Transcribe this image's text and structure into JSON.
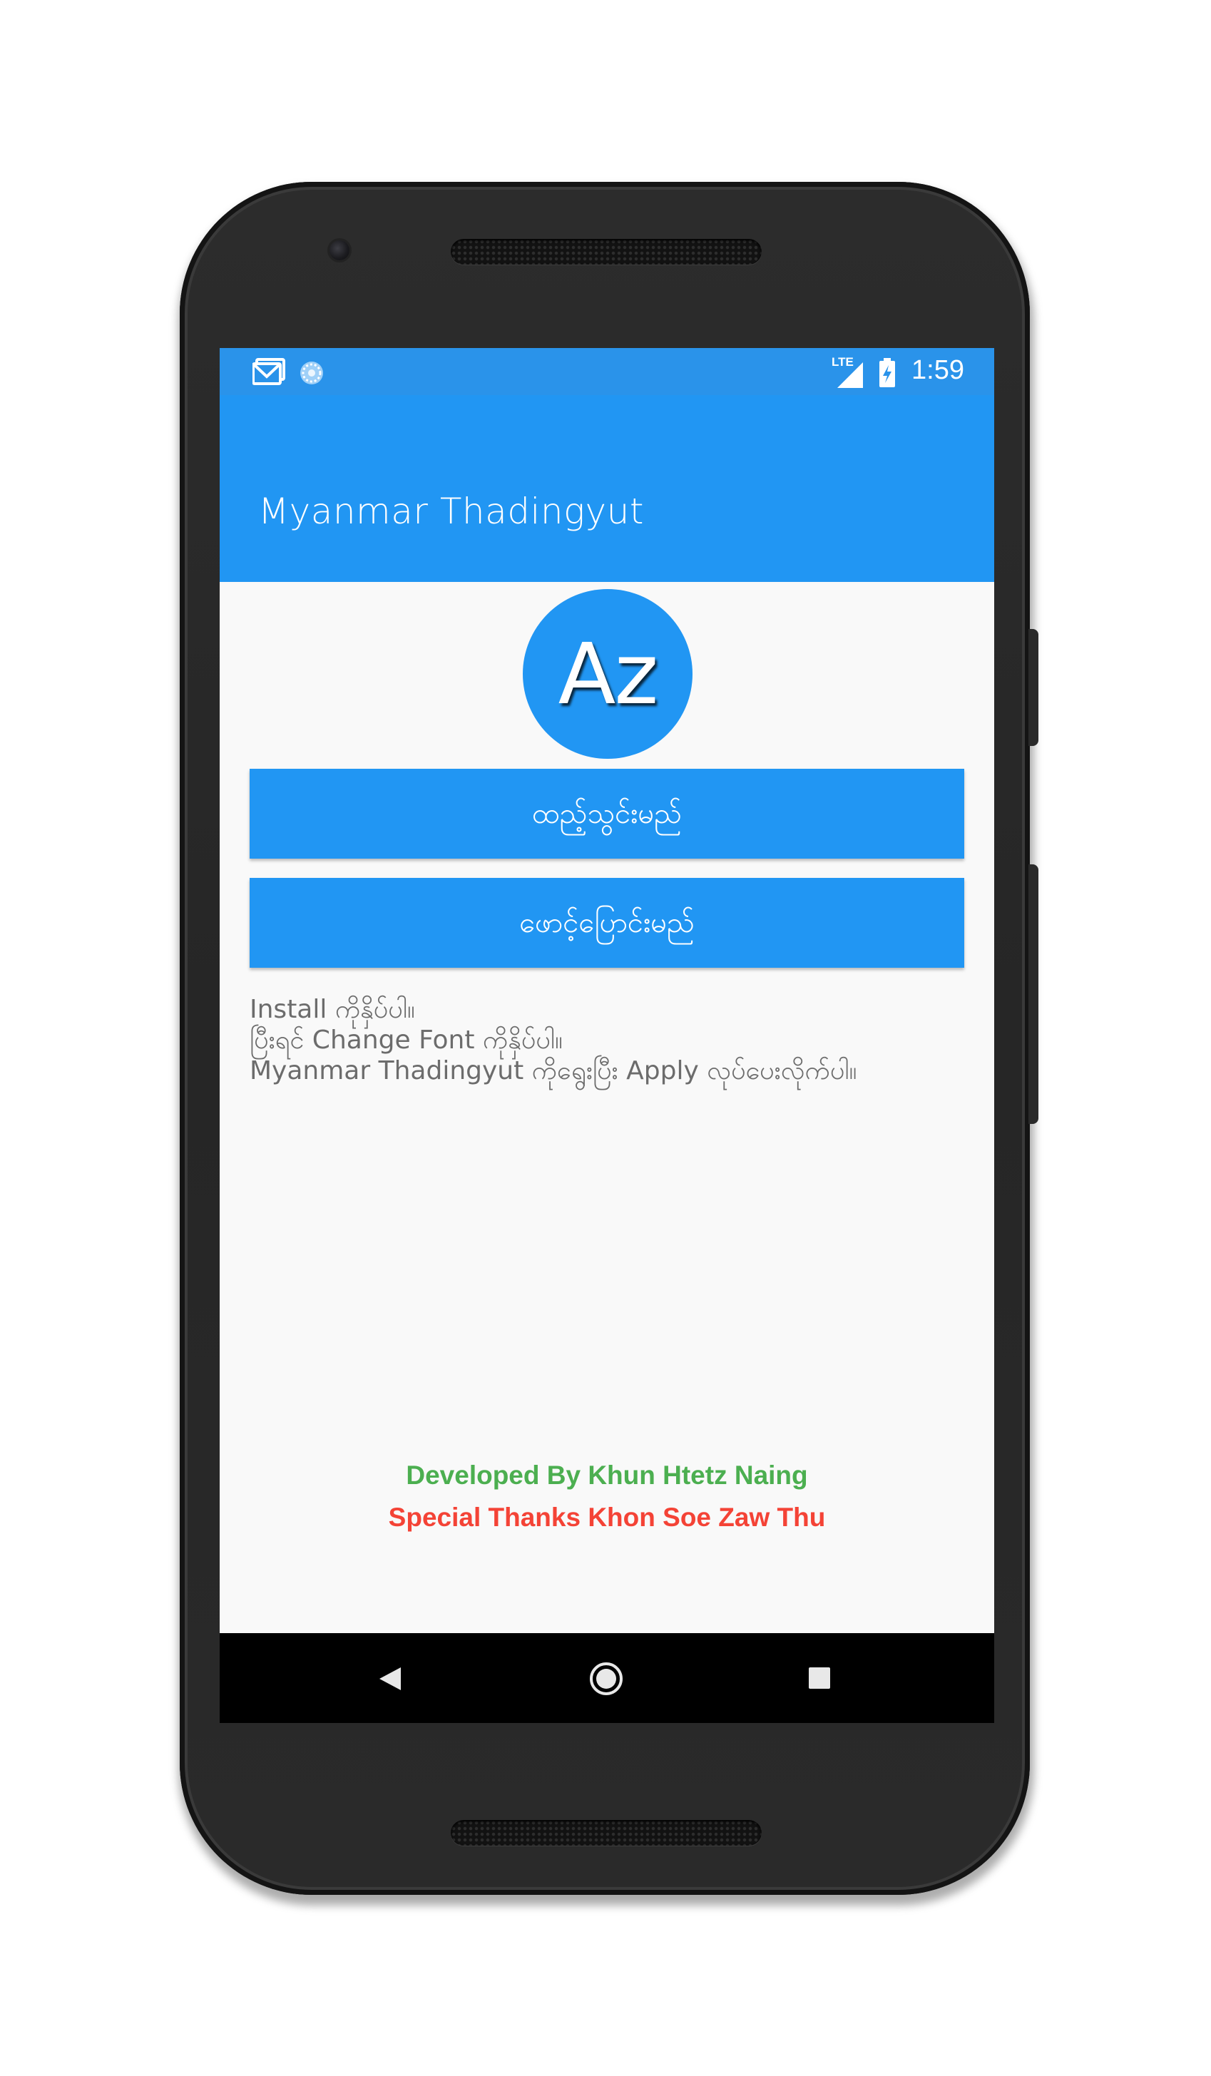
{
  "status_bar": {
    "time": "1:59",
    "network_label": "LTE",
    "notification_icons": [
      "gmail-icon",
      "loading-icon"
    ],
    "system_icons": [
      "signal-icon",
      "battery-charging-icon"
    ]
  },
  "app_bar": {
    "title": "Myanmar Thadingyut"
  },
  "logo": {
    "text": "Az"
  },
  "buttons": {
    "install_label": "ထည့်သွင်းမည်",
    "change_label": "ဖောင့်ပြောင်းမည်"
  },
  "instructions": [
    "Install ကိုနှိပ်ပါ။",
    "ပြီးရင် Change Font ကိုနှိပ်ပါ။",
    "Myanmar Thadingyut ကိုရွေးပြီး Apply လုပ်ပေးလိုက်ပါ။"
  ],
  "credits": {
    "developer": "Developed By Khun Htetz Naing",
    "thanks": "Special Thanks Khon Soe Zaw Thu"
  },
  "nav_bar": {
    "buttons": [
      "back-icon",
      "home-icon",
      "recents-icon"
    ]
  },
  "colors": {
    "primary": "#2196f3",
    "status_bar": "#2a93ea",
    "developer_credit": "#4caf50",
    "thanks_credit": "#f44336",
    "screen_background": "#f9f9f9",
    "instruction_text": "#6c6c6c"
  }
}
